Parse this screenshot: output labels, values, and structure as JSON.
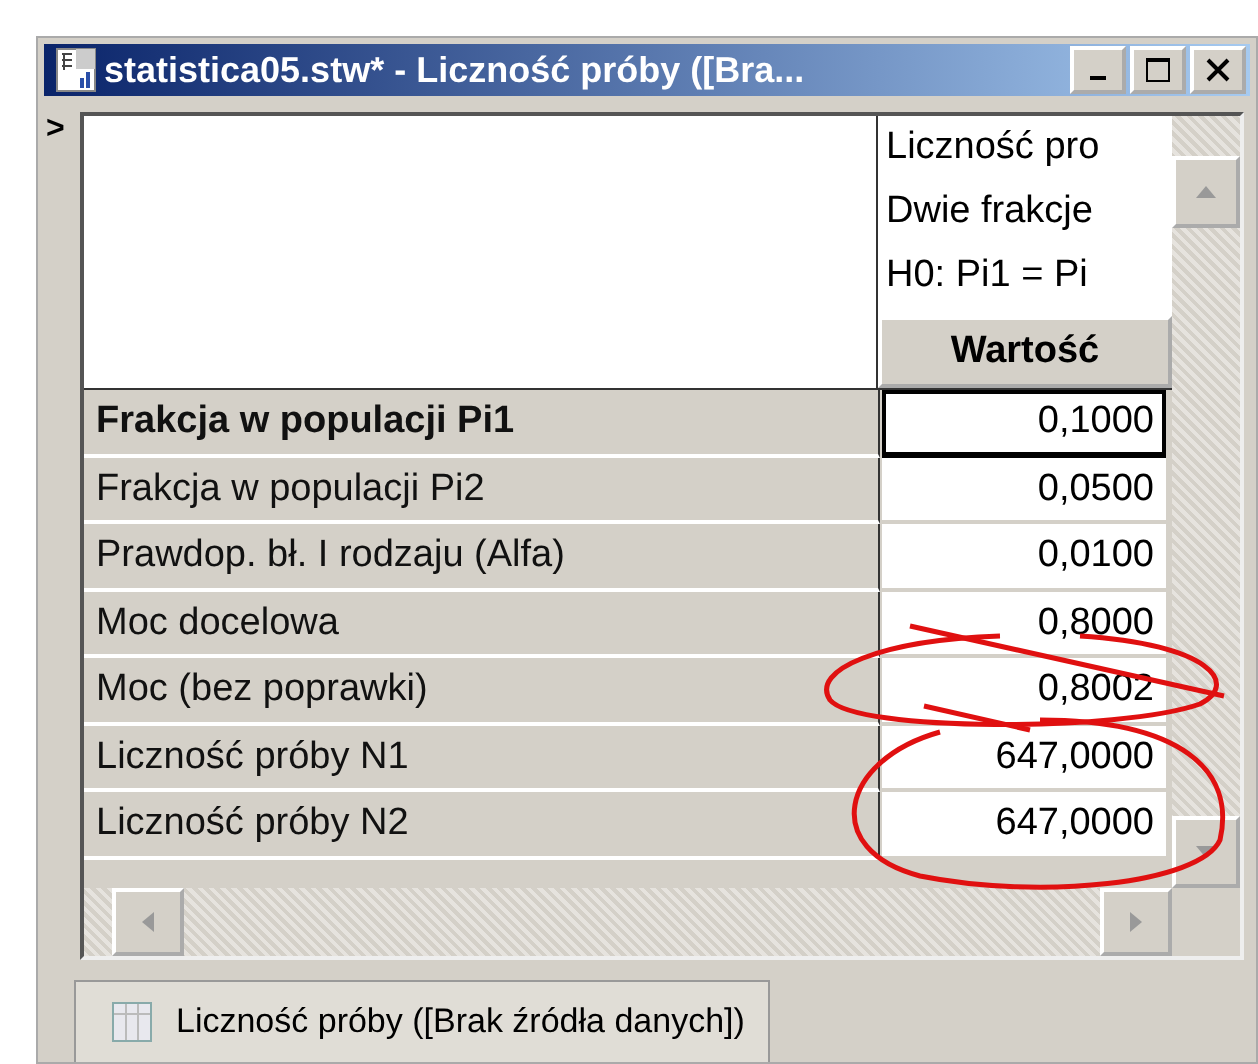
{
  "window": {
    "title": "statistica05.stw* - Liczność próby ([Bra..."
  },
  "marker": ">",
  "table": {
    "header_lines": [
      "Liczność pro",
      "Dwie frakcje",
      "H0: Pi1 = Pi"
    ],
    "column_heading": "Wartość",
    "rows": [
      {
        "label": "Frakcja w populacji Pi1",
        "value": "0,1000",
        "selected": true
      },
      {
        "label": "Frakcja w populacji Pi2",
        "value": "0,0500",
        "selected": false
      },
      {
        "label": "Prawdop. bł. I rodzaju (Alfa)",
        "value": "0,0100",
        "selected": false
      },
      {
        "label": "Moc docelowa",
        "value": "0,8000",
        "selected": false
      },
      {
        "label": "Moc (bez poprawki)",
        "value": "0,8002",
        "selected": false
      },
      {
        "label": "Liczność próby N1",
        "value": "647,0000",
        "selected": false
      },
      {
        "label": "Liczność próby N2",
        "value": "647,0000",
        "selected": false
      }
    ]
  },
  "tabs": [
    {
      "label": "Liczność próby ([Brak źródła danych])",
      "selected": true
    }
  ]
}
